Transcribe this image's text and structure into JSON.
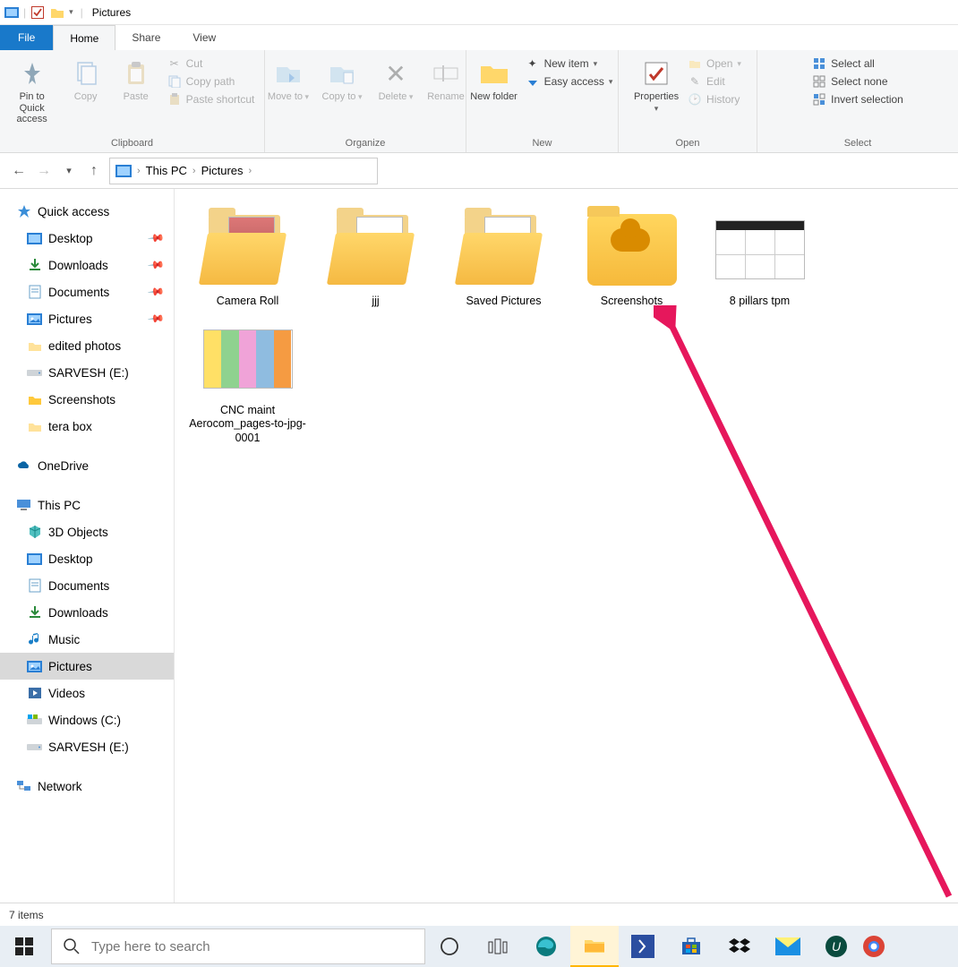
{
  "window": {
    "title": "Pictures"
  },
  "tabs": {
    "file": "File",
    "home": "Home",
    "share": "Share",
    "view": "View"
  },
  "ribbon": {
    "clipboard": {
      "label": "Clipboard",
      "pin": "Pin to Quick access",
      "copy": "Copy",
      "paste": "Paste",
      "cut": "Cut",
      "copypath": "Copy path",
      "pasteshortcut": "Paste shortcut"
    },
    "organize": {
      "label": "Organize",
      "moveto": "Move to",
      "copyto": "Copy to",
      "delete": "Delete",
      "rename": "Rename"
    },
    "new": {
      "label": "New",
      "newfolder": "New folder",
      "newitem": "New item",
      "easyaccess": "Easy access"
    },
    "open": {
      "label": "Open",
      "properties": "Properties",
      "open": "Open",
      "edit": "Edit",
      "history": "History"
    },
    "select": {
      "label": "Select",
      "selectall": "Select all",
      "selectnone": "Select none",
      "invert": "Invert selection"
    }
  },
  "breadcrumb": {
    "root": "This PC",
    "current": "Pictures"
  },
  "sidebar": {
    "quick": {
      "header": "Quick access",
      "items": [
        {
          "label": "Desktop",
          "pinned": true,
          "icon": "desktop"
        },
        {
          "label": "Downloads",
          "pinned": true,
          "icon": "downloads"
        },
        {
          "label": "Documents",
          "pinned": true,
          "icon": "documents"
        },
        {
          "label": "Pictures",
          "pinned": true,
          "icon": "pictures"
        },
        {
          "label": "edited photos",
          "pinned": false,
          "icon": "folder"
        },
        {
          "label": "SARVESH (E:)",
          "pinned": false,
          "icon": "drive"
        },
        {
          "label": "Screenshots",
          "pinned": false,
          "icon": "folder-yellow"
        },
        {
          "label": "tera box",
          "pinned": false,
          "icon": "folder"
        }
      ]
    },
    "onedrive": {
      "label": "OneDrive"
    },
    "thispc": {
      "header": "This PC",
      "items": [
        {
          "label": "3D Objects",
          "icon": "3d"
        },
        {
          "label": "Desktop",
          "icon": "desktop"
        },
        {
          "label": "Documents",
          "icon": "documents"
        },
        {
          "label": "Downloads",
          "icon": "downloads"
        },
        {
          "label": "Music",
          "icon": "music"
        },
        {
          "label": "Pictures",
          "icon": "pictures",
          "selected": true
        },
        {
          "label": "Videos",
          "icon": "videos"
        },
        {
          "label": "Windows (C:)",
          "icon": "osdrive"
        },
        {
          "label": "SARVESH (E:)",
          "icon": "drive"
        }
      ]
    },
    "network": {
      "label": "Network"
    }
  },
  "files": [
    {
      "name": "Camera Roll",
      "type": "folder-open-photo"
    },
    {
      "name": "jjj",
      "type": "folder-open-doc"
    },
    {
      "name": "Saved Pictures",
      "type": "folder-open-doc"
    },
    {
      "name": "Screenshots",
      "type": "folder-cloud"
    },
    {
      "name": "8 pillars tpm",
      "type": "image-table"
    },
    {
      "name": "CNC maint Aerocom_pages-to-jpg-0001",
      "type": "image-colorbars"
    }
  ],
  "status": {
    "count": "7 items"
  },
  "taskbar": {
    "search_placeholder": "Type here to search"
  }
}
